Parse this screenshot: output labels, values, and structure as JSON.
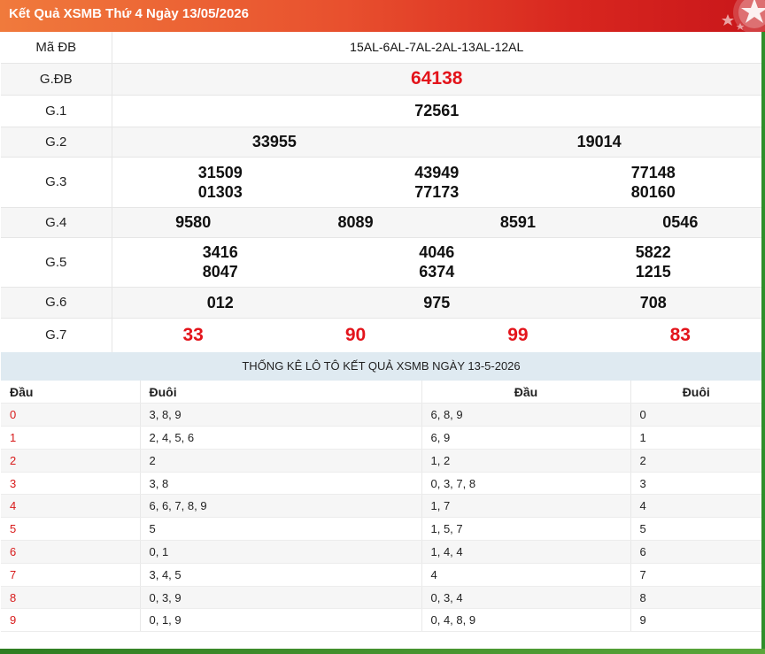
{
  "header": {
    "title": "Kết Quả XSMB Thứ 4 Ngày 13/05/2026",
    "color_start": "#f07a3c",
    "color_end": "#c8161a"
  },
  "results": {
    "ma_db": {
      "label": "Mã ĐB",
      "value": "15AL-6AL-7AL-2AL-13AL-12AL"
    },
    "g_db": {
      "label": "G.ĐB",
      "values": [
        "64138"
      ]
    },
    "g1": {
      "label": "G.1",
      "values": [
        "72561"
      ]
    },
    "g2": {
      "label": "G.2",
      "values": [
        "33955",
        "19014"
      ]
    },
    "g3": {
      "label": "G.3",
      "values": [
        [
          "31509",
          "01303"
        ],
        [
          "43949",
          "77173"
        ],
        [
          "77148",
          "80160"
        ]
      ]
    },
    "g4": {
      "label": "G.4",
      "values": [
        "9580",
        "8089",
        "8591",
        "0546"
      ]
    },
    "g5": {
      "label": "G.5",
      "values": [
        [
          "3416",
          "8047"
        ],
        [
          "4046",
          "6374"
        ],
        [
          "5822",
          "1215"
        ]
      ]
    },
    "g6": {
      "label": "G.6",
      "values": [
        "012",
        "975",
        "708"
      ]
    },
    "g7": {
      "label": "G.7",
      "values": [
        "33",
        "90",
        "99",
        "83"
      ]
    },
    "highlight_color": "#e3141b"
  },
  "stats": {
    "title": "THỐNG KÊ LÔ TÔ KẾT QUẢ XSMB NGÀY 13-5-2026",
    "headers": [
      "Đầu",
      "Đuôi",
      "Đầu",
      "Đuôi"
    ],
    "rows": [
      [
        "0",
        "3, 8, 9",
        "6, 8, 9",
        "0"
      ],
      [
        "1",
        "2, 4, 5, 6",
        "6, 9",
        "1"
      ],
      [
        "2",
        "2",
        "1, 2",
        "2"
      ],
      [
        "3",
        "3, 8",
        "0, 3, 7, 8",
        "3"
      ],
      [
        "4",
        "6, 6, 7, 8, 9",
        "1, 7",
        "4"
      ],
      [
        "5",
        "5",
        "1, 5, 7",
        "5"
      ],
      [
        "6",
        "0, 1",
        "1, 4, 4",
        "6"
      ],
      [
        "7",
        "3, 4, 5",
        "4",
        "7"
      ],
      [
        "8",
        "0, 3, 9",
        "0, 3, 4",
        "8"
      ],
      [
        "9",
        "0, 1, 9",
        "0, 4, 8, 9",
        "9"
      ]
    ]
  }
}
